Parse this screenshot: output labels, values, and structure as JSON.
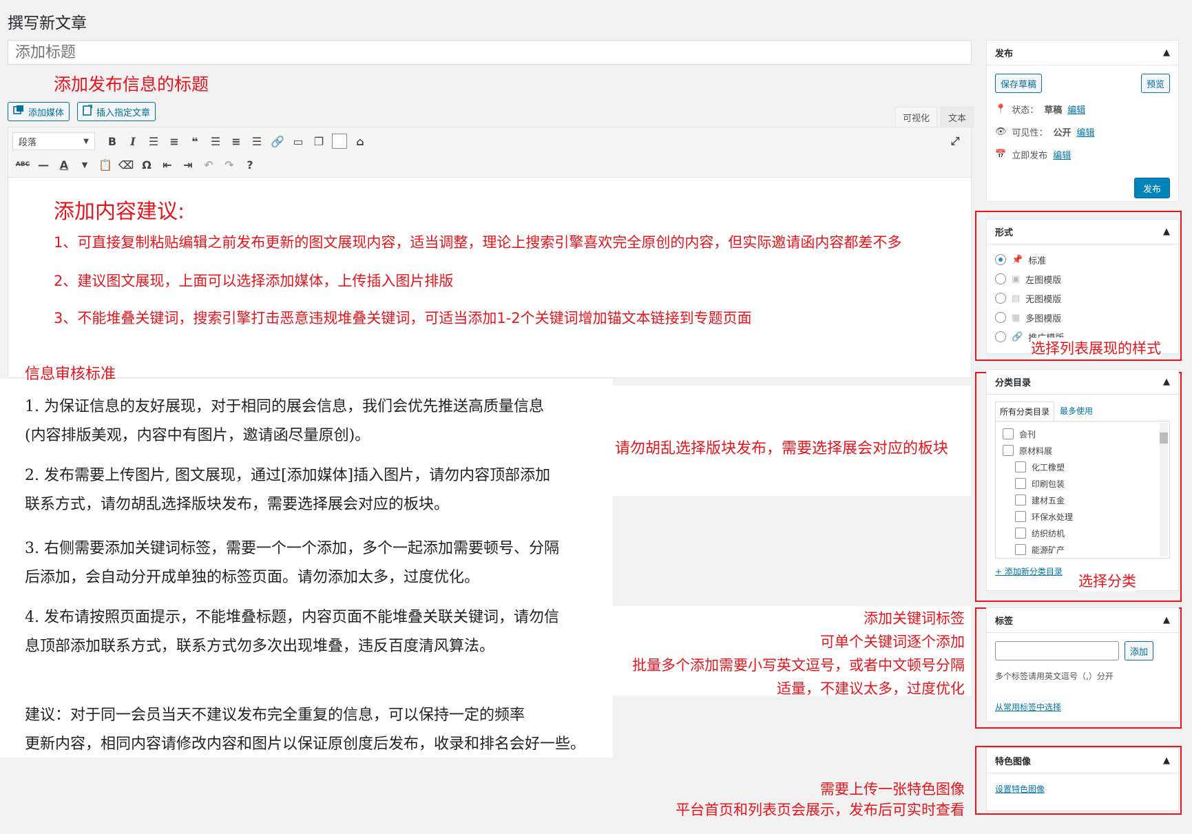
{
  "page_title": "撰写新文章",
  "title_placeholder": "添加标题",
  "title_note": "添加发布信息的标题",
  "media_buttons": {
    "add_media": "添加媒体",
    "insert_post": "插入指定文章"
  },
  "editor_tabs": {
    "visual": "可视化",
    "text": "文本"
  },
  "toolbar": {
    "format_value": "段落"
  },
  "content_tips": {
    "heading": "添加内容建议:",
    "items": [
      "1、可直接复制粘贴编辑之前发布更新的图文展现内容，适当调整，理论上搜索引擎喜欢完全原创的内容，但实际邀请函内容都差不多",
      "2、建议图文展现，上面可以选择添加媒体，上传插入图片排版",
      "3、不能堆叠关键词，搜索引擎打击恶意违规堆叠关键词，可适当添加1-2个关键词增加锚文本链接到专题页面"
    ]
  },
  "audit": {
    "title": "信息审核标准",
    "rules": [
      [
        "1. 为保证信息的友好展现，对于相同的展会信息，我们会优先推送高质量信息",
        "(内容排版美观，内容中有图片，邀请函尽量原创)。"
      ],
      [
        "2. 发布需要上传图片, 图文展现，通过[添加媒体]插入图片，请勿内容顶部添加",
        "联系方式，请勿胡乱选择版块发布，需要选择展会对应的板块。"
      ],
      [
        "3. 右侧需要添加关键词标签，需要一个一个添加，多个一起添加需要顿号、分隔",
        "后添加，会自动分开成单独的标签页面。请勿添加太多，过度优化。"
      ],
      [
        "4. 发布请按照页面提示，不能堆叠标题，内容页面不能堆叠关联关键词，请勿信",
        "息顶部添加联系方式，联系方式勿多次出现堆叠，违反百度清风算法。"
      ]
    ],
    "suggestion": [
      "建议：对于同一会员当天不建议发布完全重复的信息，可以保持一定的频率",
      "更新内容，相同内容请修改内容和图片以保证原创度后发布，收录和排名会好一些。"
    ]
  },
  "category_note": "请勿胡乱选择版块发布，需要选择展会对应的板块",
  "tag_notes": [
    "添加关键词标签",
    "可单个关键词逐个添加",
    "批量多个添加需要小写英文逗号，或者中文顿号分隔",
    "适量，不建议太多，过度优化"
  ],
  "featured_notes": [
    "需要上传一张特色图像",
    "平台首页和列表页会展示，发布后可实时查看"
  ],
  "publish_box": {
    "title": "发布",
    "save_draft": "保存草稿",
    "preview": "预览",
    "status_label": "状态：",
    "status_value": "草稿",
    "visibility_label": "可见性：",
    "visibility_value": "公开",
    "schedule_label": "立即发布",
    "edit": "编辑",
    "publish": "发布"
  },
  "format_box": {
    "title": "形式",
    "options": [
      "标准",
      "左图模版",
      "无图模版",
      "多图模版",
      "推广模版"
    ],
    "selected": "标准",
    "note": "选择列表展现的样式"
  },
  "category_box": {
    "title": "分类目录",
    "tab_all": "所有分类目录",
    "tab_popular": "最多使用",
    "items": [
      "会刊",
      "原材料展",
      "化工橡塑",
      "印刷包装",
      "建材五金",
      "环保水处理",
      "纺织纺机",
      "能源矿产"
    ],
    "add_new": "+ 添加新分类目录",
    "note": "选择分类"
  },
  "tag_box": {
    "title": "标签",
    "add_button": "添加",
    "hint": "多个标签请用英文逗号（,）分开",
    "choose_link": "从常用标签中选择"
  },
  "featured_box": {
    "title": "特色图像",
    "set_link": "设置特色图像"
  }
}
